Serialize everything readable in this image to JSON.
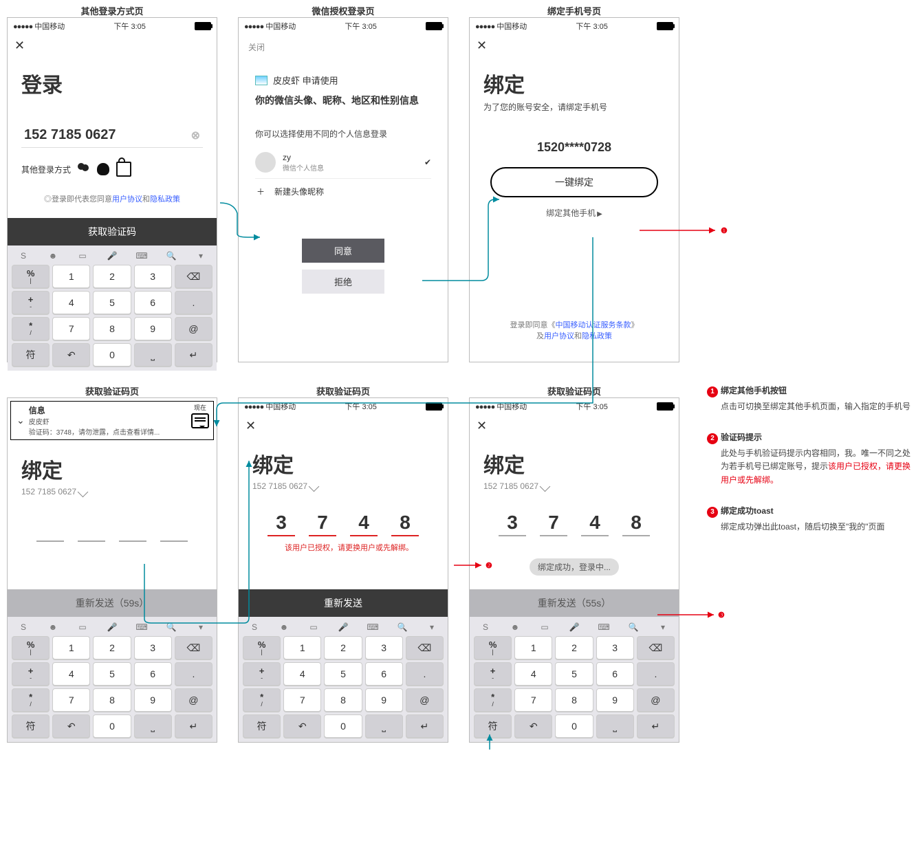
{
  "statusbar": {
    "carrier": "中国移动",
    "time": "下午 3:05"
  },
  "headers": {
    "other_login": "其他登录方式页",
    "wechat_auth": "微信授权登录页",
    "bind_phone": "绑定手机号页",
    "get_code": "获取验证码页"
  },
  "login_page": {
    "title": "登录",
    "phone_display": "152 7185 0627",
    "alt_label": "其他登录方式",
    "agree_prefix": "登录即代表您同意",
    "user_agreement": "用户协议",
    "and": "和",
    "privacy": "隐私政策",
    "get_code_btn": "获取验证码"
  },
  "keyboard": {
    "sym": "符",
    "percent": "%",
    "plus": "+",
    "minus": "-",
    "dot": ".",
    "keys": [
      "1",
      "2",
      "3",
      "4",
      "5",
      "6",
      "7",
      "8",
      "9",
      "0"
    ],
    "at": "@"
  },
  "wechat": {
    "close": "关闭",
    "app_name": "皮皮虾",
    "apply_suffix": "申请使用",
    "scope": "你的微信头像、昵称、地区和性别信息",
    "choose_label": "你可以选择使用不同的个人信息登录",
    "profile_name": "zy",
    "profile_desc": "微信个人信息",
    "new_profile": "新建头像昵称",
    "agree": "同意",
    "deny": "拒绝"
  },
  "bind": {
    "title": "绑定",
    "subtitle": "为了您的账号安全，请绑定手机号",
    "masked": "1520****0728",
    "one_tap": "一键绑定",
    "other": "绑定其他手机",
    "footer_prefix": "登录即同意《",
    "footer_cm": "中国移动认证服务条款",
    "footer_mid": "》",
    "footer_and": "及",
    "footer_ua": "用户协议",
    "footer_and2": "和",
    "footer_pp": "隐私政策"
  },
  "code_page": {
    "title": "绑定",
    "phone": "152 7185 0627",
    "error": "该用户已授权，请更换用户或先解绑。",
    "resend_prefix": "重新发送",
    "resend_59": "重新发送（59s）",
    "resend_55": "重新发送（55s）",
    "toast": "绑定成功，登录中...",
    "digits": [
      "3",
      "7",
      "4",
      "8"
    ]
  },
  "notification": {
    "title_line": "信息",
    "app": "皮皮虾",
    "body": "验证码：3748，请勿泄露，点击查看详情...",
    "now": "现在"
  },
  "callouts": {
    "c1_title": "绑定其他手机按钮",
    "c1_desc": "点击可切换至绑定其他手机页面，输入指定的手机号",
    "c2_title": "验证码提示",
    "c2_desc_a": "此处与手机验证码提示内容相同，我。唯一不同之处为若手机号已绑定账号，提示",
    "c2_desc_red": "该用户已授权，请更换用户或先解绑。",
    "c3_title": "绑定成功toast",
    "c3_desc": "绑定成功弹出此toast，随后切换至\"我的\"页面"
  }
}
